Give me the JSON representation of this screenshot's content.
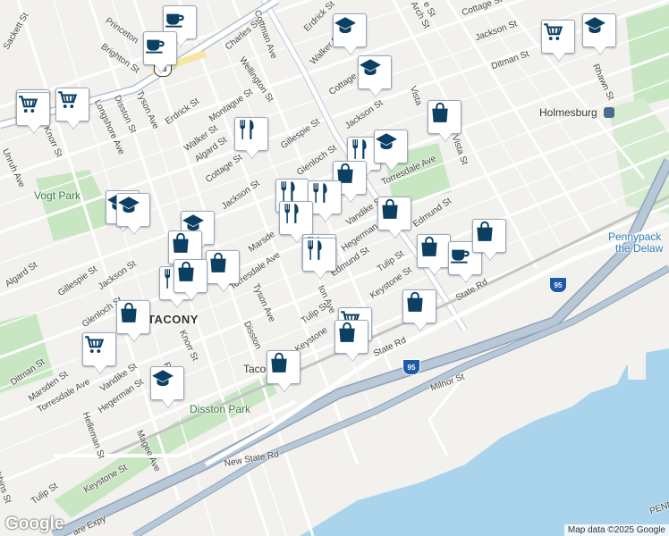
{
  "map": {
    "labels": {
      "sackett": "Sackett St",
      "princeton": "Princeton",
      "brighton": "Brighton St",
      "charles": "Charles St",
      "wellington": "Wellington St",
      "cottman": "Cottman Ave",
      "erdrick_top": "Erdrick St",
      "walker_top": "Walker St",
      "cottage_top": "Cottage St",
      "jackson_top": "Jackson St",
      "ditman_top": "Ditman St",
      "rhawn": "Rhawn St",
      "holmesburg": "Holmesburg",
      "longshore": "Longshore Ave",
      "knorr_w": "Knorr St",
      "unruh": "Unruh Ave",
      "disston": "Disston St",
      "tyson": "Tyson Ave",
      "erdrick": "Erdrick St",
      "montague": "Montague St",
      "walker": "Walker St",
      "algard": "Algard St",
      "cottage": "Cottage St",
      "gillespie_n": "Gillespie St",
      "jackson_n": "Jackson St",
      "cottage_n": "Cottage",
      "jackson_c": "Jackson St",
      "vista": "Vista St",
      "vista2": "Vista",
      "glenloch": "Glenloch St",
      "torresdale_n": "Torresdale Ave",
      "vogt": "Vogt Park",
      "jackson_w": "Jackson St",
      "marsden_c": "Marsde",
      "vandike": "Vandike St",
      "edmund_e": "Edmund St",
      "hegerman": "Hegerman",
      "torresdale_c": "Torresdale Ave",
      "pennypack1": "Pennypack",
      "pennypack2": "the Delaw",
      "algard_w": "Algard St",
      "gillespie_w": "Gillespie St",
      "jackson_w2": "Jackson St",
      "glenloch_w": "Glenloch St",
      "tulip_e": "Tulip St",
      "keystone_e": "Keystone St",
      "edmund": "Edmund St",
      "tyson_s": "Tyson Ave",
      "state_rd_e": "State Rd",
      "tacony": "TACONY",
      "ton_ave": "ton Ave",
      "tulip": "Tulip St",
      "disston_s": "Disston",
      "keystone": "Keystone",
      "knorr": "Knorr St",
      "ditman": "Ditman St",
      "marsden": "Marsden St",
      "torresdale_s": "Torresdale Ave",
      "vandike_s": "Vandike St",
      "hegerman_s": "Hegerman St",
      "helleman": "Helleman St",
      "re": "Re",
      "taco": "Taco",
      "state_rd_s": "State Rd",
      "milnor": "Milnor St",
      "disston_park": "Disston Park",
      "magee": "Magee Ave",
      "new_state": "New State Rd",
      "keystone_sw": "Keystone St",
      "tulip_sw": "Tulip St",
      "obbins": "obbins St",
      "expy": "are Expy",
      "penn": "PENN",
      "arch": "Arch St",
      "e_st": "e St"
    },
    "shields": {
      "i95": "95",
      "us13": "13"
    },
    "pins": [
      {
        "type": "coffee"
      },
      {
        "type": "cart"
      },
      {
        "type": "coffee"
      },
      {
        "type": "school"
      },
      {
        "type": "school"
      },
      {
        "type": "cart"
      },
      {
        "type": "school"
      },
      {
        "type": "cart"
      },
      {
        "type": "cart"
      },
      {
        "type": "restaurant"
      },
      {
        "type": "bag"
      },
      {
        "type": "restaurant"
      },
      {
        "type": "school"
      },
      {
        "type": "bag"
      },
      {
        "type": "restaurant"
      },
      {
        "type": "restaurant"
      },
      {
        "type": "bag"
      },
      {
        "type": "restaurant"
      },
      {
        "type": "school"
      },
      {
        "type": "school"
      },
      {
        "type": "school"
      },
      {
        "type": "bag"
      },
      {
        "type": "bag"
      },
      {
        "type": "restaurant"
      },
      {
        "type": "restaurant"
      },
      {
        "type": "bag"
      },
      {
        "type": "bag"
      },
      {
        "type": "restaurant"
      },
      {
        "type": "coffee"
      },
      {
        "type": "bag"
      },
      {
        "type": "bag"
      },
      {
        "type": "cart"
      },
      {
        "type": "bag"
      },
      {
        "type": "bag"
      },
      {
        "type": "cart"
      },
      {
        "type": "school"
      },
      {
        "type": "bag"
      }
    ],
    "logo": "Google",
    "attribution": "Map data ©2025 Google"
  }
}
